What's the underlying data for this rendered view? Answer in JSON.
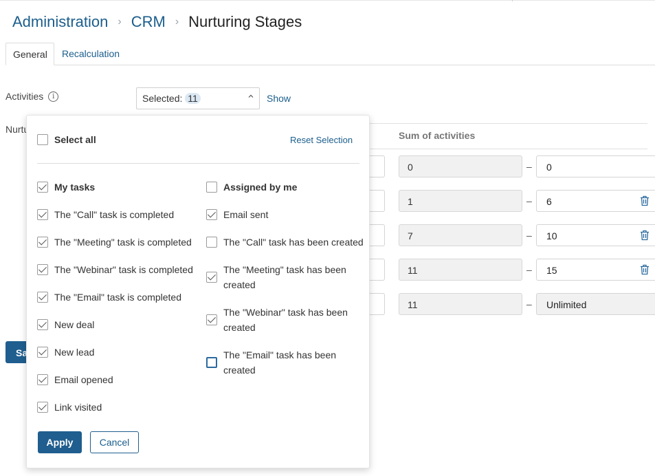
{
  "breadcrumb": {
    "items": [
      "Administration",
      "CRM"
    ],
    "separator": "›",
    "current": "Nurturing Stages"
  },
  "tabs": [
    {
      "label": "General",
      "active": true
    },
    {
      "label": "Recalculation",
      "active": false
    }
  ],
  "activities": {
    "label": "Activities",
    "info_icon": "info-icon",
    "selected_prefix": "Selected: ",
    "selected_count": "11",
    "show_link": "Show"
  },
  "nurturing_label": "Nurtu",
  "table": {
    "column_header": "Sum of activities",
    "rows": [
      {
        "from": "0",
        "to": "0",
        "deletable": false
      },
      {
        "from": "1",
        "to": "6",
        "deletable": true
      },
      {
        "from": "7",
        "to": "10",
        "deletable": true
      },
      {
        "from": "11",
        "to": "15",
        "deletable": true
      },
      {
        "from": "11",
        "to": "Unlimited",
        "deletable": false
      }
    ],
    "dash": "–"
  },
  "save_button": "Sa",
  "dropdown": {
    "select_all": {
      "label": "Select all",
      "checked": false
    },
    "reset_label": "Reset Selection",
    "left_column": [
      {
        "label": "My tasks",
        "checked": true,
        "bold": true
      },
      {
        "label": "The \"Call\" task is completed",
        "checked": true
      },
      {
        "label": "The \"Meeting\" task is completed",
        "checked": true
      },
      {
        "label": "The \"Webinar\" task is completed",
        "checked": true
      },
      {
        "label": "The \"Email\" task is completed",
        "checked": true
      },
      {
        "label": "New deal",
        "checked": true
      },
      {
        "label": "New lead",
        "checked": true
      },
      {
        "label": "Email opened",
        "checked": true
      },
      {
        "label": "Link visited",
        "checked": true
      }
    ],
    "right_column": [
      {
        "label_1": "Assigned by me",
        "checked": false,
        "bold": true
      },
      {
        "label_1": "Email sent",
        "checked": true
      },
      {
        "label_1": "The \"Call\" task has been created",
        "checked": false
      },
      {
        "label_1": "The \"Meeting\" task has been",
        "label_2": "created",
        "checked": true
      },
      {
        "label_1": "The \"Webinar\" task has been",
        "label_2": "created",
        "checked": true
      },
      {
        "label_1": "The \"Email\" task has been",
        "label_2": "created",
        "checked": false,
        "focused": true
      }
    ],
    "apply_label": "Apply",
    "cancel_label": "Cancel"
  },
  "colors": {
    "accent": "#1f5e8e",
    "link": "#1b5e8c",
    "readonly_bg": "#f1f1f1"
  }
}
